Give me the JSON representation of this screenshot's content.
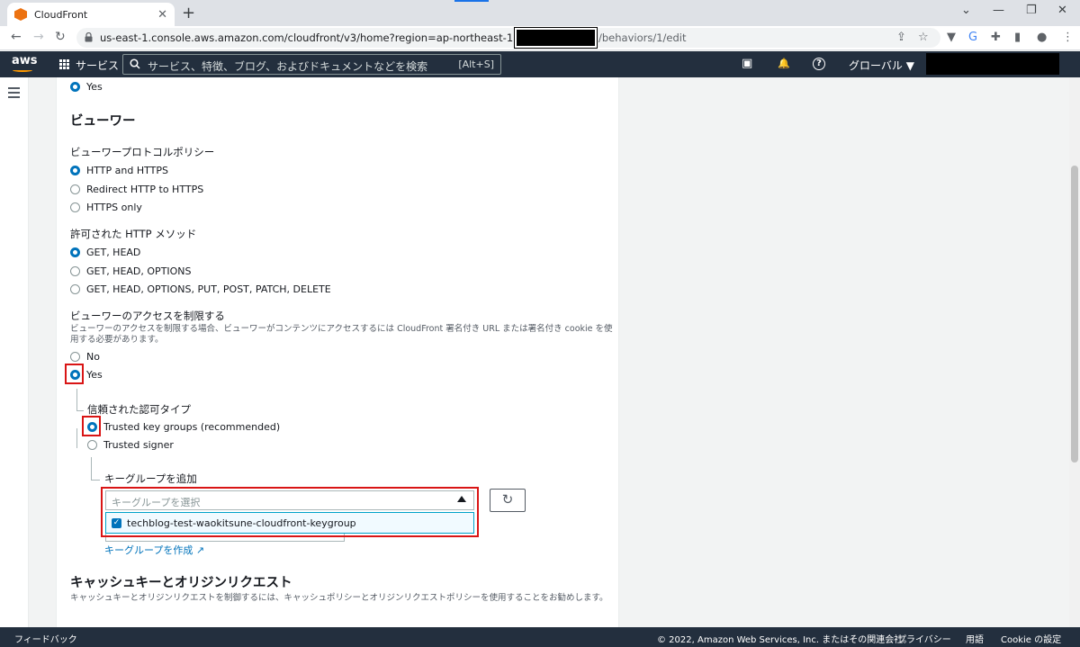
{
  "browser": {
    "tab_title": "CloudFront",
    "tab_close": "✕",
    "new_tab": "+",
    "url_prefix": "us-east-1.console.aws.amazon.com/cloudfront/v3/home?region=ap-northeast-1#/distributions/",
    "url_suffix": "/behaviors/1/edit",
    "win_minimize": "—",
    "win_restore": "❐",
    "win_close": "✕",
    "back": "←",
    "forward": "→",
    "reload": "↻",
    "share": "⇪",
    "star": "☆",
    "ext1": "▼",
    "ext2": "G",
    "ext3": "✚",
    "ext4": "▮",
    "profile": "●",
    "menu": "⋮",
    "chevron": "⌄"
  },
  "aws_nav": {
    "logo": "aws",
    "services": "サービス",
    "search_placeholder": "サービス、特徴、ブログ、およびドキュメントなどを検索",
    "search_shortcut": "[Alt+S]",
    "cloudshell_icon": "▣",
    "bell_icon": "🔔",
    "help_icon": "?",
    "region": "グローバル ▼"
  },
  "content": {
    "top_yes": "Yes",
    "viewer_heading": "ビューワー",
    "protocol_label": "ビューワープロトコルポリシー",
    "protocol_options": [
      "HTTP and HTTPS",
      "Redirect HTTP to HTTPS",
      "HTTPS only"
    ],
    "methods_label": "許可された HTTP メソッド",
    "methods_options": [
      "GET, HEAD",
      "GET, HEAD, OPTIONS",
      "GET, HEAD, OPTIONS, PUT, POST, PATCH, DELETE"
    ],
    "restrict_label": "ビューワーのアクセスを制限する",
    "restrict_desc_1": "ビューワーのアクセスを制限する場合、ビューワーがコンテンツにアクセスするには CloudFront 署名付き URL または署名付き cookie を使",
    "restrict_desc_2": "用する必要があります。",
    "restrict_no": "No",
    "restrict_yes": "Yes",
    "trust_label": "信頼された認可タイプ",
    "trust_options": [
      "Trusted key groups (recommended)",
      "Trusted signer"
    ],
    "keygroup_label": "キーグループを追加",
    "keygroup_placeholder": "キーグループを選択",
    "keygroup_option": "techblog-test-waokitsune-cloudfront-keygroup",
    "checkmark": "✓",
    "refresh_icon": "↻",
    "create_keygroup_link": "キーグループを作成 ↗",
    "cache_heading": "キャッシュキーとオリジンリクエスト",
    "cache_desc": "キャッシュキーとオリジンリクエストを制御するには、キャッシュポリシーとオリジンリクエストポリシーを使用することをお勧めします。"
  },
  "footer": {
    "feedback": "フィードバック",
    "copyright": "© 2022, Amazon Web Services, Inc. またはその関連会社。",
    "privacy": "プライバシー",
    "terms": "用語",
    "cookie": "Cookie の設定"
  }
}
